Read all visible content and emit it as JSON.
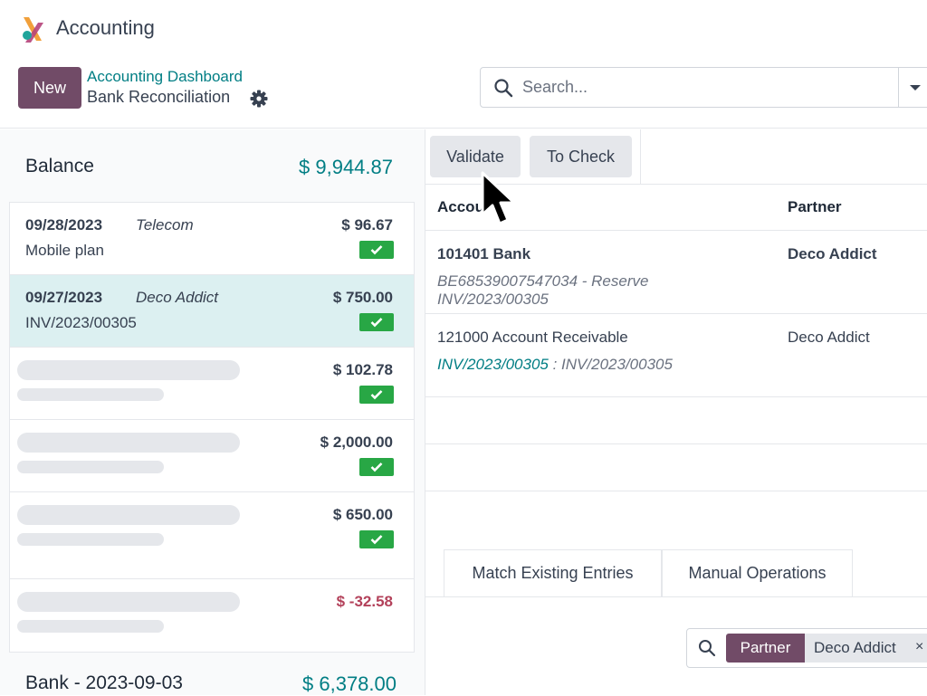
{
  "app": {
    "title": "Accounting"
  },
  "control_panel": {
    "new_label": "New",
    "breadcrumb_parent": "Accounting Dashboard",
    "breadcrumb_current": "Bank Reconciliation",
    "search_placeholder": "Search..."
  },
  "left_panel": {
    "balance_label": "Balance",
    "balance_amount": "$ 9,944.87",
    "statements": [
      {
        "date": "09/28/2023",
        "partner": "Telecom",
        "ref": "Mobile plan",
        "amount": "$ 96.67"
      },
      {
        "date": "09/27/2023",
        "partner": "Deco Addict",
        "ref": "INV/2023/00305",
        "amount": "$ 750.00"
      },
      {
        "amount": "$ 102.78"
      },
      {
        "amount": "$ 2,000.00"
      },
      {
        "amount": "$ 650.00"
      },
      {
        "amount": "$ -32.58"
      }
    ],
    "bank_label": "Bank - 2023-09-03",
    "bank_amount": "$ 6,378.00"
  },
  "right_panel": {
    "validate_label": "Validate",
    "to_check_label": "To Check",
    "col_account": "Accou",
    "col_partner": "Partner",
    "lines": [
      {
        "account": "101401 Bank",
        "partner": "Deco Addict",
        "sub_line1": "BE68539007547034 - Reserve",
        "sub_line2": "INV/2023/00305"
      },
      {
        "account": "121000 Account Receivable",
        "partner": "Deco Addict",
        "sub_link": "INV/2023/00305",
        "sub_text": " : INV/2023/00305"
      }
    ],
    "tabs": [
      "Match Existing Entries",
      "Manual Operations"
    ],
    "filter": {
      "facet_label": "Partner",
      "facet_value": "Deco Addict",
      "remove": "×"
    }
  },
  "colors": {
    "brand": "#714b67",
    "accent": "#017e84",
    "success": "#28a745",
    "negative": "#b3415a",
    "selected_row": "#dcf0f1"
  },
  "icons": [
    "app-logo-icon",
    "gear-icon",
    "search-icon",
    "chevron-down-icon",
    "check-icon",
    "mouse-pointer-icon",
    "close-icon"
  ]
}
